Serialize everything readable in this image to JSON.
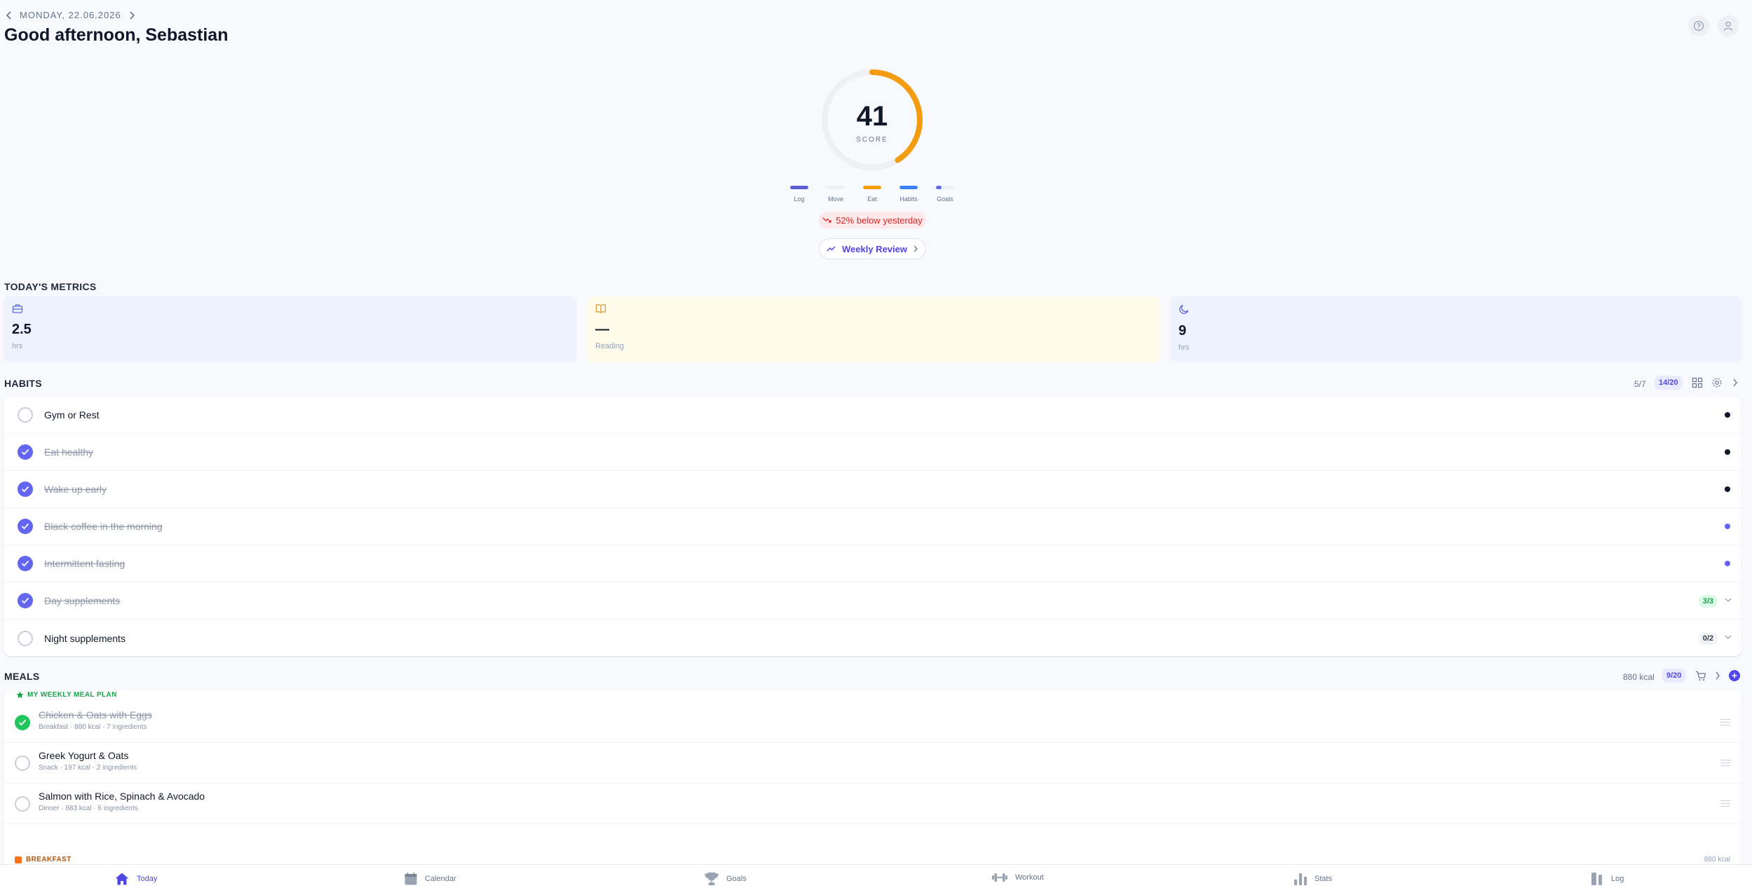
{
  "header": {
    "date": "MONDAY, 22.06.2026",
    "greeting": "Good afternoon, Sebastian",
    "icons": [
      "chevron-left-icon",
      "chevron-right-icon",
      "help-icon",
      "user-icon"
    ]
  },
  "score": {
    "value": "41",
    "label": "SCORE",
    "progress": 0.41,
    "ring_color": "#f39c12",
    "categories": [
      {
        "label": "Log",
        "fill": 1.0,
        "color": "#5b5bd6"
      },
      {
        "label": "Move",
        "fill": 0.0,
        "color": "#e5e7eb"
      },
      {
        "label": "Eat",
        "fill": 1.0,
        "color": "#f59e0b"
      },
      {
        "label": "Habits",
        "fill": 1.0,
        "color": "#3b82f6"
      },
      {
        "label": "Goals",
        "fill": 0.3,
        "color": "#6366f1"
      }
    ],
    "comparison": "52% below yesterday",
    "review_button": "Weekly Review"
  },
  "metrics": {
    "title": "TODAY'S METRICS",
    "items": [
      {
        "icon": "briefcase-icon",
        "value": "2.5",
        "unit": "hrs",
        "bg": "#eef2fd",
        "icon_color": "#5b6bd6"
      },
      {
        "icon": "book-icon",
        "value": "—",
        "unit": "Reading",
        "bg": "#fefaea",
        "icon_color": "#e0a03a"
      },
      {
        "icon": "moon-icon",
        "value": "9",
        "unit": "hrs",
        "bg": "#eef2fd",
        "icon_color": "#5b6bd6"
      }
    ]
  },
  "habits": {
    "title": "HABITS",
    "count": "5/7",
    "streak": "14/20",
    "items": [
      {
        "label": "Gym or Rest",
        "done": false,
        "dot": "#111827"
      },
      {
        "label": "Eat healthy",
        "done": true,
        "dot": "#111827"
      },
      {
        "label": "Wake up early",
        "done": true,
        "dot": "#111827"
      },
      {
        "label": "Black coffee in the morning",
        "done": true,
        "dot": "#6366f1"
      },
      {
        "label": "Intermittent fasting",
        "done": true,
        "dot": "#6366f1"
      },
      {
        "label": "Day supplements",
        "done": true,
        "badge": "3/3"
      },
      {
        "label": "Night supplements",
        "done": false,
        "badge": "0/2"
      }
    ]
  },
  "meals": {
    "title": "MEALS",
    "kcal": "880 kcal",
    "count": "9/20",
    "plan_label": "MY WEEKLY MEAL PLAN",
    "items": [
      {
        "title": "Chicken & Oats with Eggs",
        "sub": "Breakfast · 880 kcal · 7 ingredients",
        "done": true
      },
      {
        "title": "Greek Yogurt & Oats",
        "sub": "Snack · 197 kcal · 2 ingredients",
        "done": false
      },
      {
        "title": "Salmon with Rice, Spinach & Avocado",
        "sub": "Dinner · 883 kcal · 6 ingredients",
        "done": false
      }
    ],
    "next_section": "BREAKFAST",
    "next_kcal": "880 kcal"
  },
  "nav": [
    {
      "label": "Today",
      "icon": "home-icon",
      "active": true
    },
    {
      "label": "Calendar",
      "icon": "calendar-icon",
      "active": false
    },
    {
      "label": "Goals",
      "icon": "trophy-icon",
      "active": false
    },
    {
      "label": "Workout",
      "icon": "dumbbell-icon",
      "active": false
    },
    {
      "label": "Stats",
      "icon": "bar-chart-icon",
      "active": false
    },
    {
      "label": "Log",
      "icon": "log-icon",
      "active": false
    }
  ]
}
